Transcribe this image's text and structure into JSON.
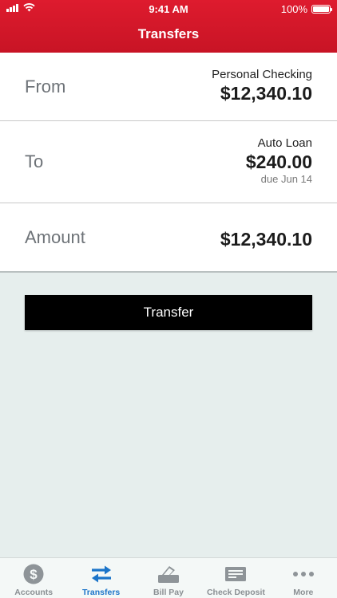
{
  "status_bar": {
    "time": "9:41 AM",
    "battery": "100%"
  },
  "header": {
    "title": "Transfers"
  },
  "rows": {
    "from": {
      "label": "From",
      "account": "Personal Checking",
      "amount": "$12,340.10"
    },
    "to": {
      "label": "To",
      "account": "Auto Loan",
      "amount": "$240.00",
      "due": "due Jun 14"
    },
    "amount": {
      "label": "Amount",
      "amount": "$12,340.10"
    }
  },
  "actions": {
    "transfer_label": "Transfer"
  },
  "tabbar": {
    "items": [
      {
        "label": "Accounts",
        "icon": "dollar-circle-icon",
        "active": false
      },
      {
        "label": "Transfers",
        "icon": "transfer-arrows-icon",
        "active": true
      },
      {
        "label": "Bill Pay",
        "icon": "bill-pay-icon",
        "active": false
      },
      {
        "label": "Check Deposit",
        "icon": "check-icon",
        "active": false
      },
      {
        "label": "More",
        "icon": "more-dots-icon",
        "active": false
      }
    ]
  },
  "colors": {
    "header_red": "#d9192b",
    "tab_active": "#1b74c9",
    "tab_inactive": "#8a8f93",
    "background": "#e6eeed"
  }
}
